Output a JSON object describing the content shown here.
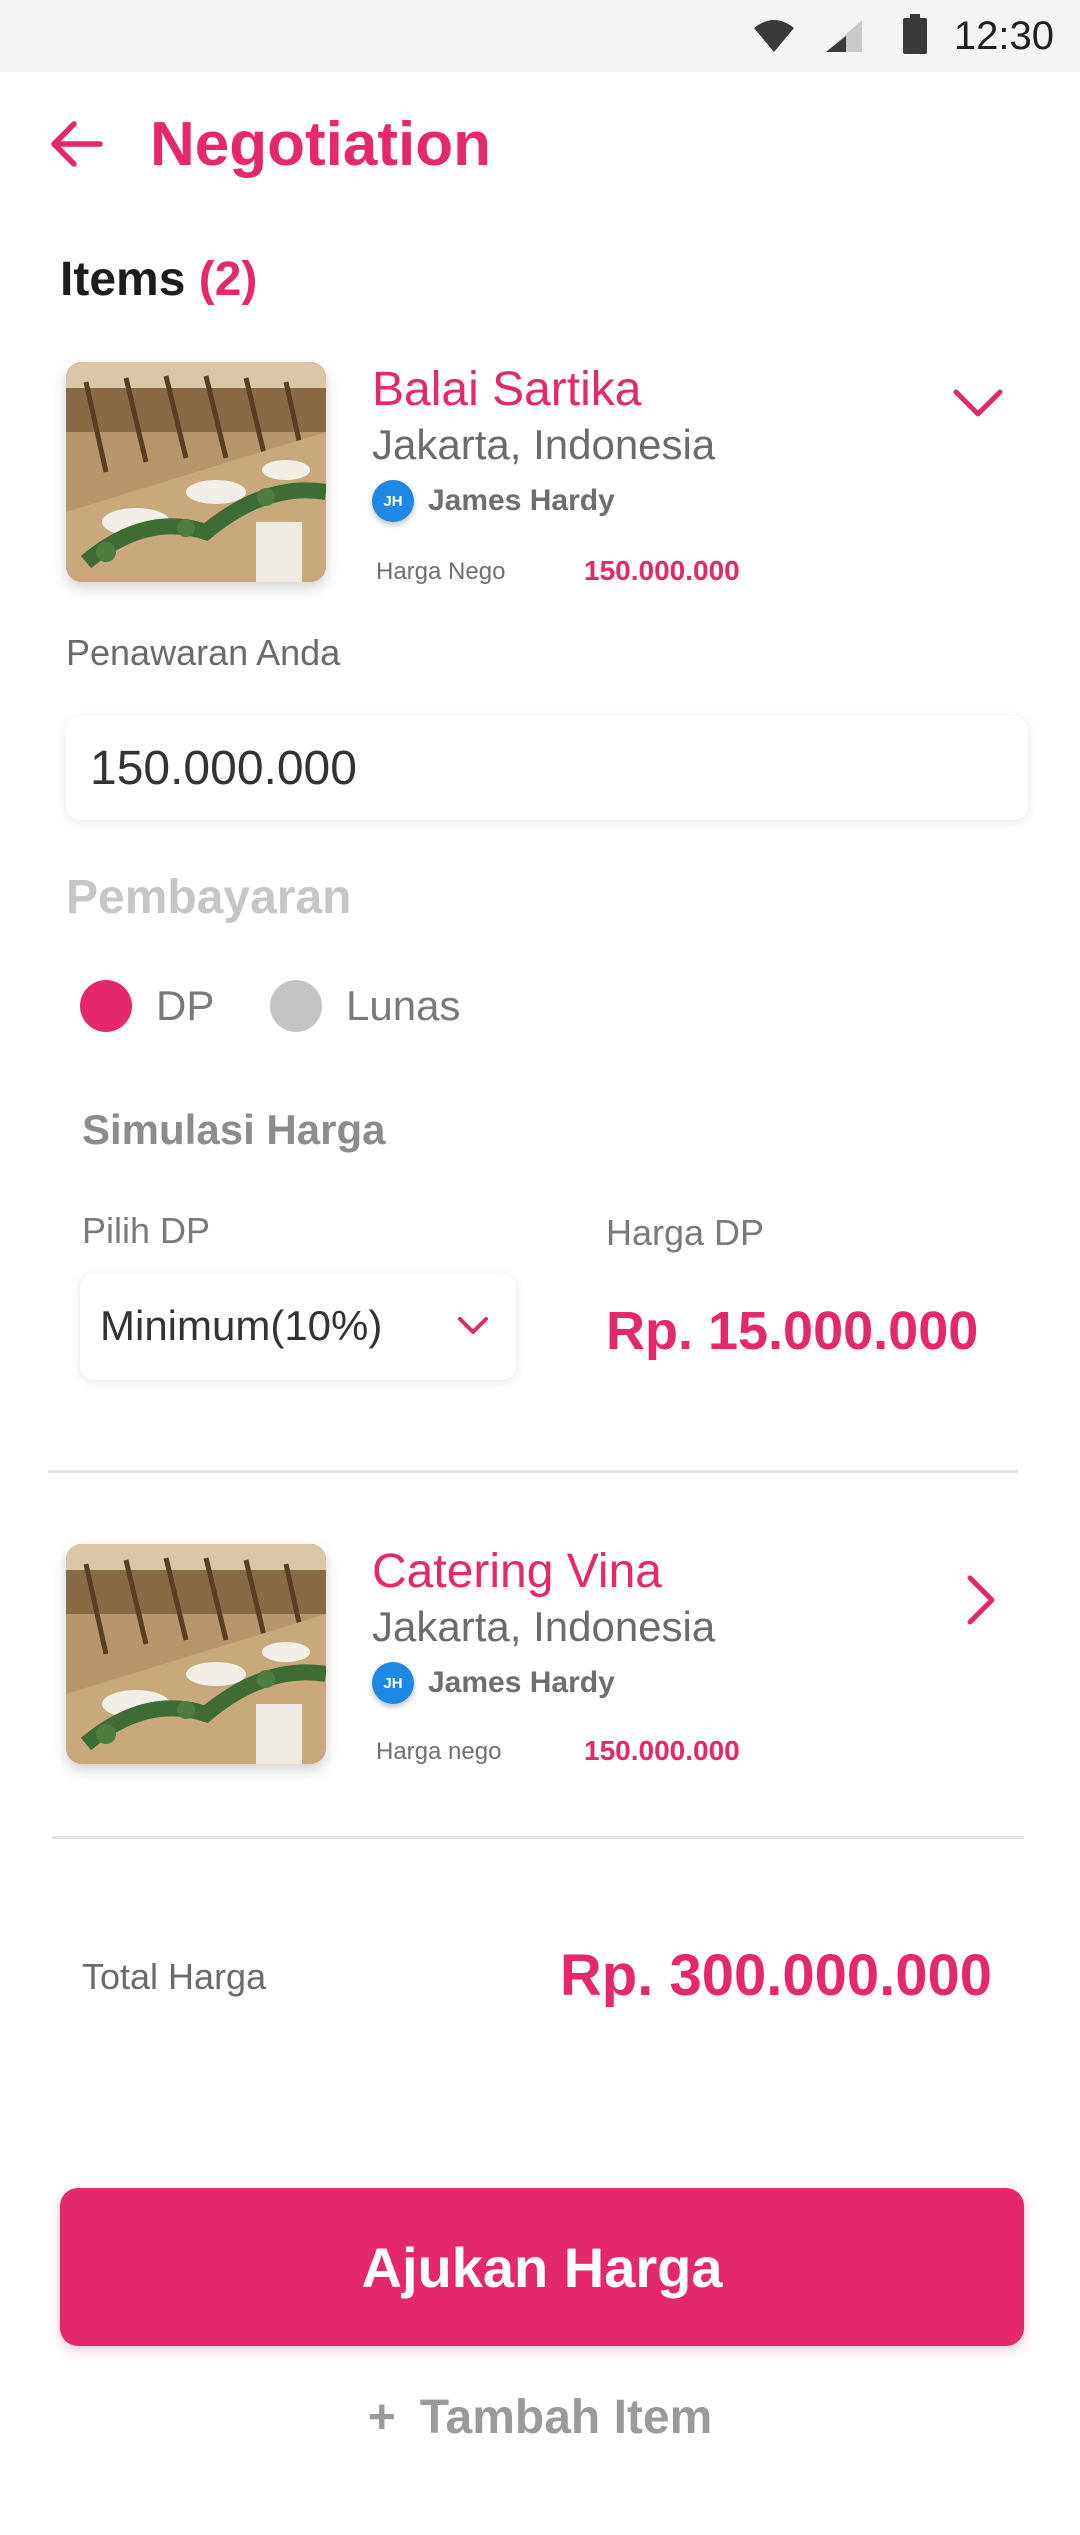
{
  "status_bar": {
    "time": "12:30"
  },
  "header": {
    "title": "Negotiation"
  },
  "items_section": {
    "label": "Items",
    "count": "(2)"
  },
  "items": [
    {
      "name": "Balai Sartika",
      "location": "Jakarta, Indonesia",
      "avatar_initials": "JH",
      "vendor": "James Hardy",
      "nego_label": "Harga Nego",
      "nego_value": "150.000.000"
    },
    {
      "name": "Catering Vina",
      "location": "Jakarta, Indonesia",
      "avatar_initials": "JH",
      "vendor": "James Hardy",
      "nego_label": "Harga nego",
      "nego_value": "150.000.000"
    }
  ],
  "offer": {
    "label": "Penawaran Anda",
    "value": "150.000.000"
  },
  "payment": {
    "heading": "Pembayaran",
    "options": [
      {
        "label": "DP",
        "selected": true
      },
      {
        "label": "Lunas",
        "selected": false
      }
    ]
  },
  "simulation": {
    "heading": "Simulasi Harga",
    "pick_label": "Pilih DP",
    "pick_value": "Minimum(10%)",
    "dp_label": "Harga DP",
    "dp_value": "Rp. 15.000.000"
  },
  "total": {
    "label": "Total Harga",
    "value": "Rp. 300.000.000"
  },
  "actions": {
    "submit": "Ajukan Harga",
    "add_plus": "+",
    "add_item": "Tambah Item"
  },
  "colors": {
    "accent": "#e5276b",
    "muted": "#c6c6c6",
    "avatar": "#1e88e5"
  }
}
